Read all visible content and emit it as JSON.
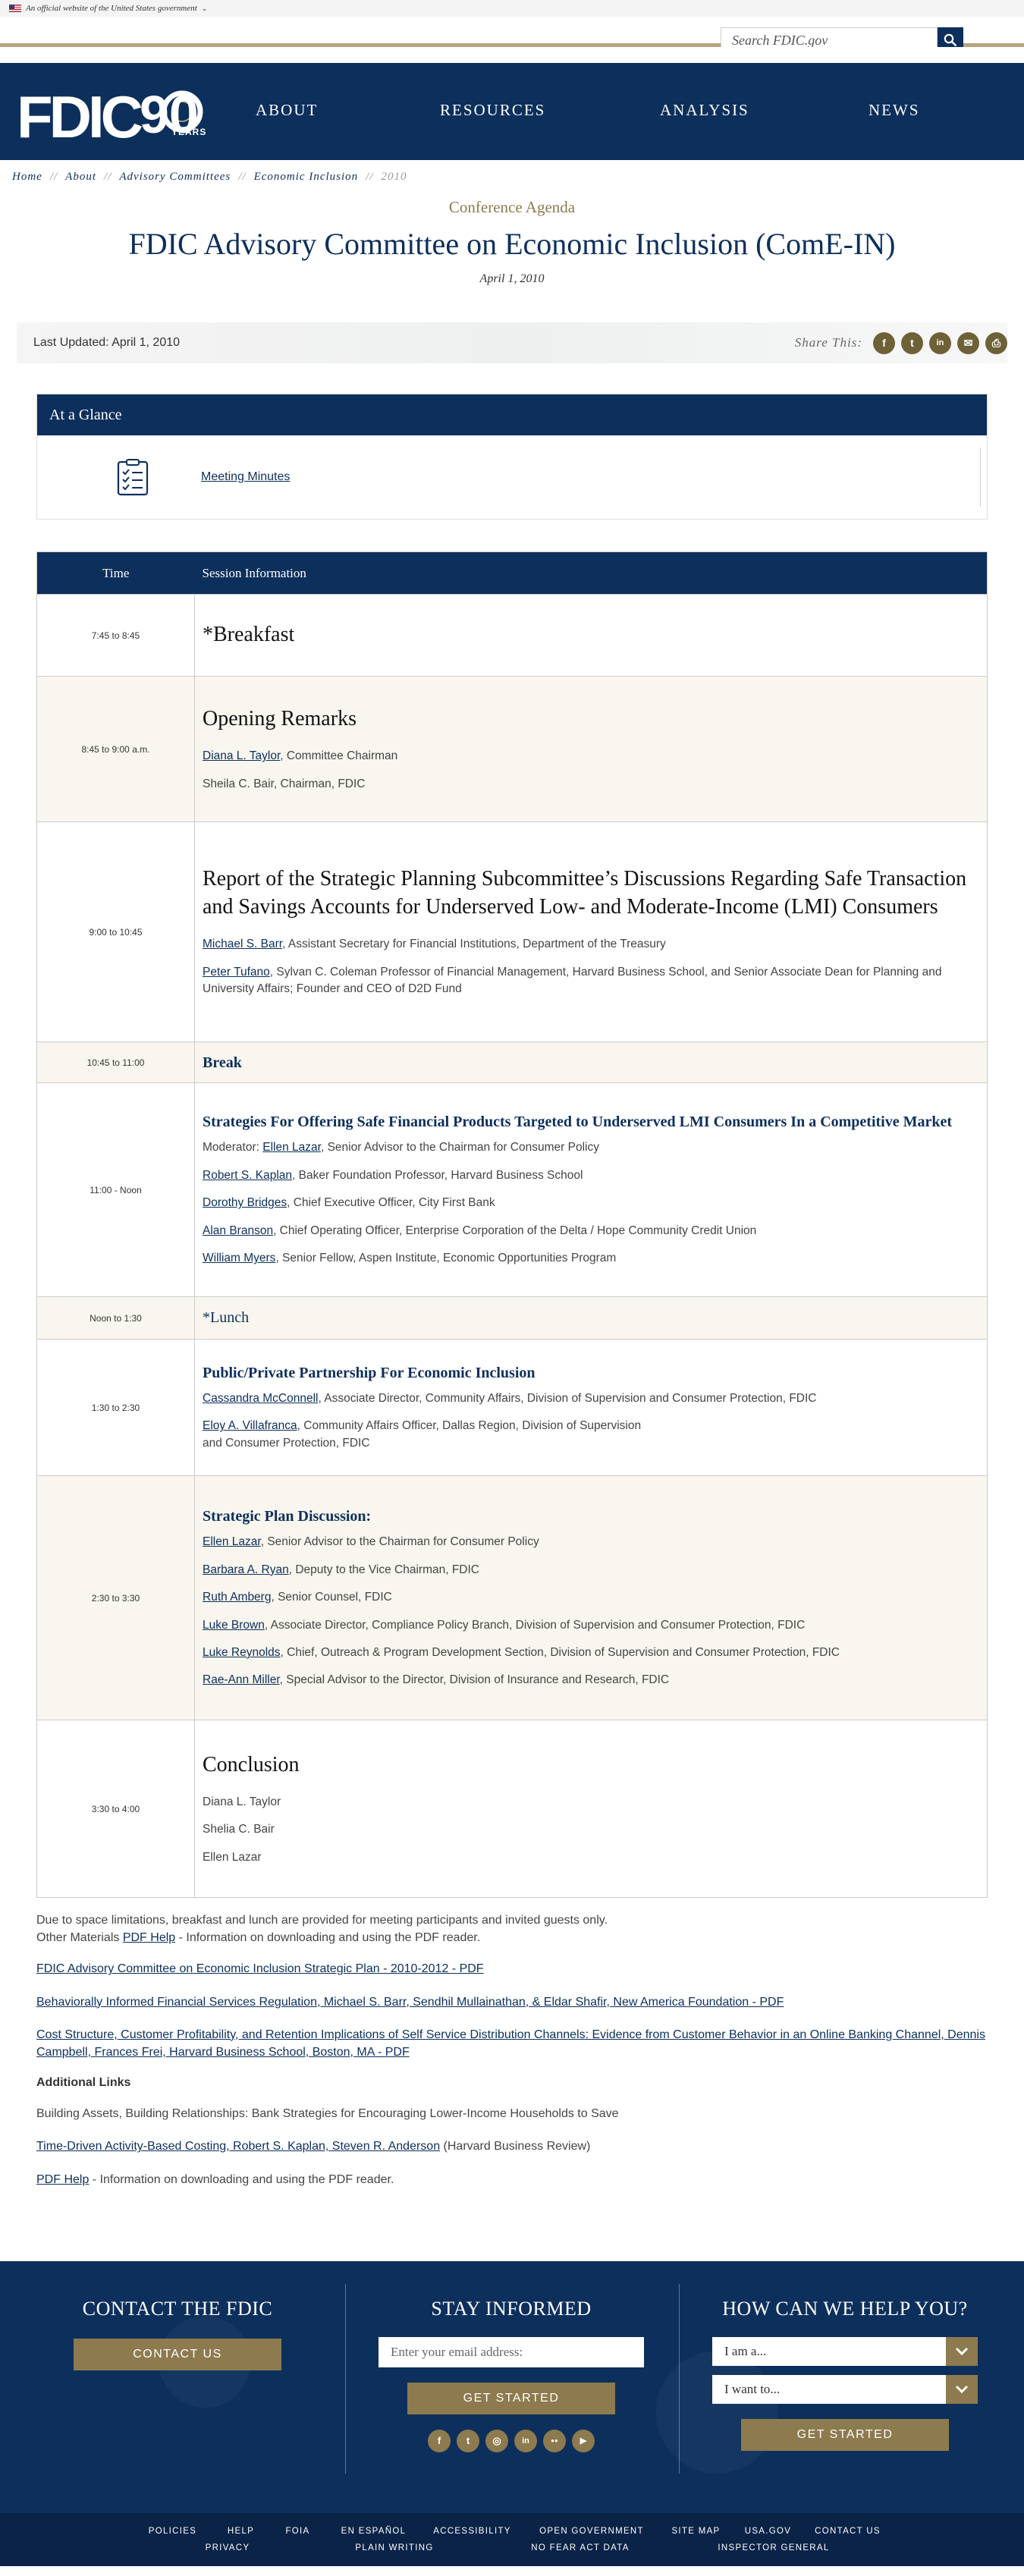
{
  "gov_banner": {
    "text": "An official website of the United States government",
    "chevron": "chevron-down-icon"
  },
  "search": {
    "placeholder": "Search FDIC.gov",
    "icon": "search-icon"
  },
  "header": {
    "logo_text": "FDIC",
    "logo_number": "90",
    "logo_sub": "YEARS",
    "nav": [
      "ABOUT",
      "RESOURCES",
      "ANALYSIS",
      "NEWS"
    ]
  },
  "breadcrumb": [
    "Home",
    "About",
    "Advisory Committees",
    "Economic Inclusion",
    "2010"
  ],
  "kicker": "Conference Agenda",
  "title": "FDIC Advisory Committee on Economic Inclusion (ComE-IN)",
  "date": "April 1, 2010",
  "updated": "Last Updated: April 1, 2010",
  "share": {
    "label": "Share This:",
    "icons": [
      "facebook-icon",
      "twitter-icon",
      "linkedin-icon",
      "email-icon",
      "print-icon"
    ],
    "glyphs": [
      "f",
      "t",
      "in",
      "✉",
      "⎙"
    ]
  },
  "glance": {
    "heading": "At a Glance",
    "link": "Meeting Minutes",
    "icon": "checklist-icon"
  },
  "agenda": {
    "headers": {
      "time": "Time",
      "session": "Session Information"
    },
    "rows": {
      "r1": {
        "time": "7:45 to 8:45",
        "title": "*Breakfast"
      },
      "r2": {
        "time": "8:45 to 9:00 a.m.",
        "title": "Opening Remarks",
        "p1_link": "Diana L. Taylor",
        "p1_text": ", Committee Chairman",
        "p2_text": "Sheila C. Bair, Chairman, FDIC"
      },
      "r3": {
        "time": "9:00 to 10:45",
        "title": "Report of the Strategic Planning Subcommittee’s Discussions Regarding Safe Transaction and Savings Accounts for Underserved Low- and Moderate-Income (LMI) Consumers",
        "p1_link": "Michael S. Barr",
        "p1_text": ",  Assistant Secretary for Financial Institutions, Department of the Treasury",
        "p2_link": "Peter Tufano",
        "p2_text": ", Sylvan C. Coleman Professor of Financial Management, Harvard Business School, and Senior Associate Dean for Planning and University Affairs; Founder and CEO of D2D Fund"
      },
      "r4": {
        "time": "10:45 to 11:00",
        "title": "Break"
      },
      "r5": {
        "time": "11:00 - Noon",
        "title": "Strategies For Offering Safe Financial Products Targeted to Underserved LMI Consumers In a Competitive Market",
        "p1_pre": "Moderator: ",
        "p1_link": "Ellen Lazar",
        "p1_text": ", Senior Advisor to the Chairman for Consumer Policy",
        "p2_link": "Robert S. Kaplan",
        "p2_text": ", Baker Foundation Professor, Harvard Business School",
        "p3_link": "Dorothy Bridges",
        "p3_text": ", Chief Executive Officer, City First Bank",
        "p4_link": "Alan Branson",
        "p4_text": ",  Chief Operating Officer, Enterprise Corporation of the Delta / Hope Community Credit Union",
        "p5_link": "William Myers",
        "p5_text": ", Senior Fellow, Aspen Institute, Economic Opportunities Program"
      },
      "r6": {
        "time": "Noon to 1:30",
        "title": "*Lunch"
      },
      "r7": {
        "time": "1:30 to 2:30",
        "title": "Public/Private Partnership For Economic Inclusion",
        "p1_link": "Cassandra McConnell",
        "p1_text": ", Associate Director, Community Affairs, Division of Supervision and Consumer Protection, FDIC",
        "p2_link": "Eloy A. Villafranca",
        "p2_text": ", Community Affairs Officer, Dallas Region, Division of Supervision",
        "p2_cont": "and Consumer Protection, FDIC"
      },
      "r8": {
        "time": "2:30 to 3:30",
        "title": "Strategic Plan Discussion:",
        "p1_link": "Ellen Lazar",
        "p1_text": ", Senior Advisor to the Chairman for Consumer Policy",
        "p2_link": "Barbara A. Ryan",
        "p2_text": ", Deputy to the Vice Chairman, FDIC",
        "p3_link": "Ruth Amberg",
        "p3_text": ", Senior Counsel, FDIC",
        "p4_link": "Luke Brown",
        "p4_text": ", Associate Director, Compliance Policy Branch, Division of Supervision and Consumer Protection, FDIC",
        "p5_link": "Luke Reynolds",
        "p5_text": ", Chief, Outreach & Program Development Section, Division of Supervision and Consumer Protection, FDIC",
        "p6_link": "Rae-Ann Miller",
        "p6_text": ", Special Advisor to the Director, Division of Insurance and Research, FDIC"
      },
      "r9": {
        "time": "3:30 to 4:00",
        "title": "Conclusion",
        "p1_text": "Diana L. Taylor",
        "p2_text": "Shelia C. Bair",
        "p3_text": "Ellen Lazar"
      }
    }
  },
  "notes": {
    "line1": "Due to space limitations, breakfast and lunch are provided for meeting participants and invited guests only.",
    "line2_pre": "Other Materials ",
    "line2_link": "PDF Help",
    "line2_post": " - Information on downloading and using the PDF reader.",
    "doc1": "FDIC Advisory Committee on Economic Inclusion Strategic Plan - 2010-2012 - PDF",
    "doc2": "Behaviorally Informed Financial Services Regulation, Michael S. Barr, Sendhil Mullainathan, & Eldar Shafir, New America Foundation - PDF",
    "doc3": "Cost Structure, Customer Profitability, and Retention Implications of Self Service Distribution Channels: Evidence from Customer Behavior in an Online Banking Channel, Dennis Campbell, Frances Frei, Harvard Business School, Boston, MA - PDF",
    "additional_heading": "Additional Links",
    "extra1": "Building Assets, Building Relationships: Bank Strategies for Encouraging Lower-Income Households to Save",
    "extra2_link": "Time-Driven Activity-Based Costing, Robert S. Kaplan, Steven R. Anderson",
    "extra2_text": "  (Harvard Business Review)",
    "extra3_link": "PDF Help",
    "extra3_text": " - Information on downloading and using the PDF reader."
  },
  "footer": {
    "contact_heading": "CONTACT THE FDIC",
    "contact_button": "CONTACT US",
    "stay_heading": "STAY INFORMED",
    "email_placeholder": "Enter your email address:",
    "stay_button": "GET STARTED",
    "social": [
      "f",
      "t",
      "◎",
      "in",
      "●●",
      "▶"
    ],
    "help_heading": "HOW CAN WE HELP YOU?",
    "select1": "I am a...",
    "select2": "I want to...",
    "help_button": "GET STARTED",
    "links_row1": [
      "POLICIES",
      "HELP",
      "FOIA",
      "EN ESPAÑOL",
      "ACCESSIBILITY",
      "OPEN GOVERNMENT",
      "SITE MAP",
      "USA.GOV",
      "CONTACT US"
    ],
    "links_row2": [
      "PRIVACY",
      "PLAIN WRITING",
      "NO FEAR ACT DATA",
      "INSPECTOR GENERAL"
    ]
  },
  "colors": {
    "navy": "#0d2f5c",
    "gold": "#8d7a4e",
    "share": "#6e6137"
  }
}
